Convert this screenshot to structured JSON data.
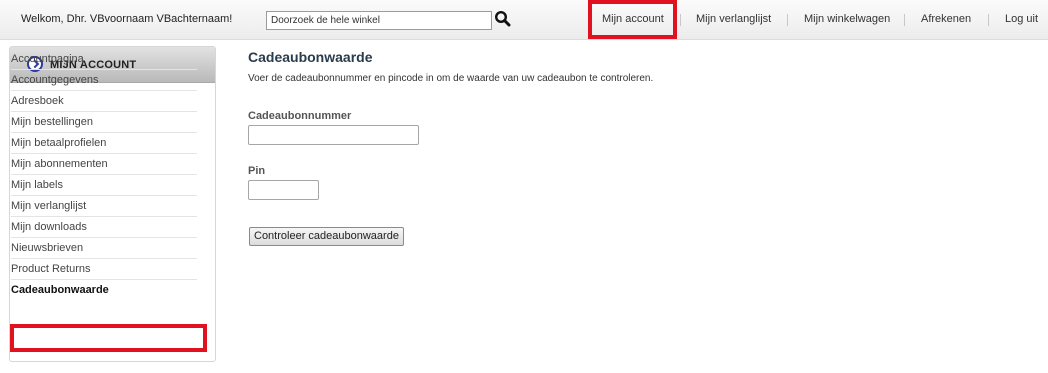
{
  "header": {
    "welcome": "Welkom, Dhr. VBvoornaam VBachternaam!",
    "search_placeholder": "Doorzoek de hele winkel",
    "nav": {
      "account": "Mijn account",
      "wishlist": "Mijn verlanglijst",
      "cart": "Mijn winkelwagen",
      "checkout": "Afrekenen",
      "logout": "Log uit"
    }
  },
  "sidebar": {
    "title": "MIJN ACCOUNT",
    "items": [
      {
        "label": "Accountpagina"
      },
      {
        "label": "Accountgegevens"
      },
      {
        "label": "Adresboek"
      },
      {
        "label": "Mijn bestellingen"
      },
      {
        "label": "Mijn betaalprofielen"
      },
      {
        "label": "Mijn abonnementen"
      },
      {
        "label": "Mijn labels"
      },
      {
        "label": "Mijn verlanglijst"
      },
      {
        "label": "Mijn downloads"
      },
      {
        "label": "Nieuwsbrieven"
      },
      {
        "label": "Product Returns"
      },
      {
        "label": "Cadeaubonwaarde"
      }
    ]
  },
  "main": {
    "title": "Cadeaubonwaarde",
    "intro": "Voer de cadeaubonnummer en pincode in om de waarde van uw cadeaubon te controleren.",
    "card_number_label": "Cadeaubonnummer",
    "card_number_value": "",
    "pin_label": "Pin",
    "pin_value": "",
    "check_button": "Controleer cadeaubonwaarde"
  },
  "colors": {
    "highlight": "#e0121f",
    "title_text": "#2a3b4c",
    "sidebar_icon": "#2d3a9e"
  }
}
